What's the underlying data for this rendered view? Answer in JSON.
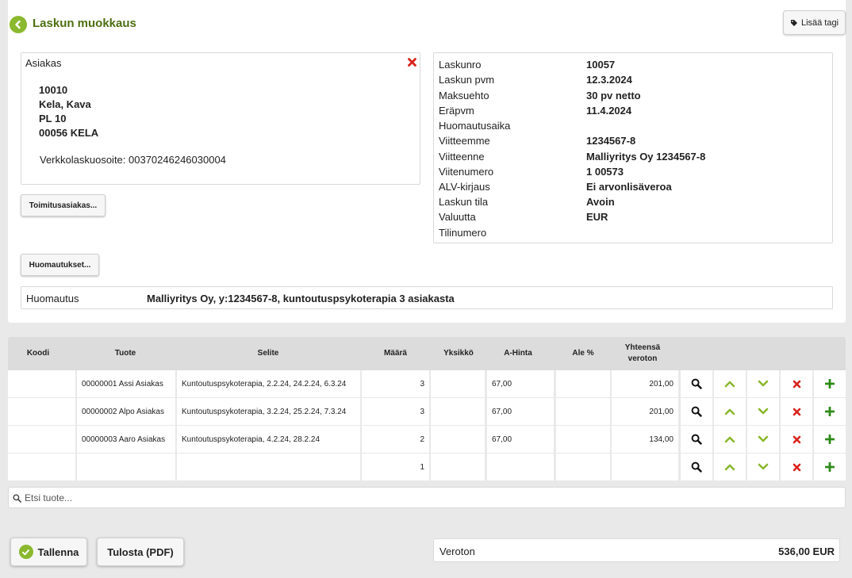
{
  "header": {
    "title": "Laskun muokkaus",
    "tag_button": "Lisää tagi"
  },
  "customer": {
    "heading": "Asiakas",
    "lines": [
      "10010",
      "Kela, Kava",
      "PL 10",
      "00056 KELA"
    ],
    "ebill": "Verkkolaskuosoite: 003702462460300​04"
  },
  "buttons": {
    "delivery_customer": "Toimitusasiakas...",
    "remarks": "Huomautukset...",
    "save": "Tallenna",
    "print": "Tulosta (PDF)"
  },
  "invoice_info": [
    {
      "label": "Laskunro",
      "value": "10057"
    },
    {
      "label": "Laskun pvm",
      "value": "12.3.2024"
    },
    {
      "label": "Maksuehto",
      "value": "30 pv netto"
    },
    {
      "label": "Eräpvm",
      "value": "11.4.2024"
    },
    {
      "label": "Huomautusaika",
      "value": ""
    },
    {
      "label": "Viitteemme",
      "value": "1234567-8"
    },
    {
      "label": "Viitteenne",
      "value": "Malliyritys Oy 1234567-8"
    },
    {
      "label": "Viitenumero",
      "value": "1 00573"
    },
    {
      "label": "ALV-kirjaus",
      "value": "Ei arvonlisäveroa"
    },
    {
      "label": "Laskun tila",
      "value": "Avoin"
    },
    {
      "label": "Valuutta",
      "value": "EUR"
    },
    {
      "label": "Tilinumero",
      "value": ""
    }
  ],
  "note": {
    "label": "Huomautus",
    "value": "Malliyritys Oy, y:1234567-8, kuntoutuspsykoterapia 3 asiakasta"
  },
  "table": {
    "columns": [
      "Koodi",
      "Tuote",
      "Selite",
      "Määrä",
      "Yksikkö",
      "A-Hinta",
      "Ale %",
      "Yhteensä veroton"
    ],
    "rows": [
      {
        "code": "",
        "product": "00000001 Assi Asiakas",
        "desc": "Kuntoutuspsykoterapia, 2.2.24, 24.2.24, 6.3.24",
        "qty": "3",
        "unit": "",
        "price": "67,00",
        "discount": "",
        "total": "201,00"
      },
      {
        "code": "",
        "product": "00000002 Alpo Asiakas",
        "desc": "Kuntoutuspsykoterapia, 3.2.24, 25.2.24, 7.3.24",
        "qty": "3",
        "unit": "",
        "price": "67,00",
        "discount": "",
        "total": "201,00"
      },
      {
        "code": "",
        "product": "00000003 Aaro Asiakas",
        "desc": "Kuntoutuspsykoterapia, 4.2.24, 28.2.24",
        "qty": "2",
        "unit": "",
        "price": "67,00",
        "discount": "",
        "total": "134,00"
      },
      {
        "code": "",
        "product": "",
        "desc": "",
        "qty": "1",
        "unit": "",
        "price": "",
        "discount": "",
        "total": ""
      }
    ]
  },
  "search": {
    "placeholder": "Etsi tuote..."
  },
  "total": {
    "label": "Veroton",
    "value": "536,00 EUR"
  },
  "colors": {
    "accent": "#8ab82e",
    "title": "#4e6f12",
    "delete": "#d9231c",
    "add": "#2e8a18"
  }
}
